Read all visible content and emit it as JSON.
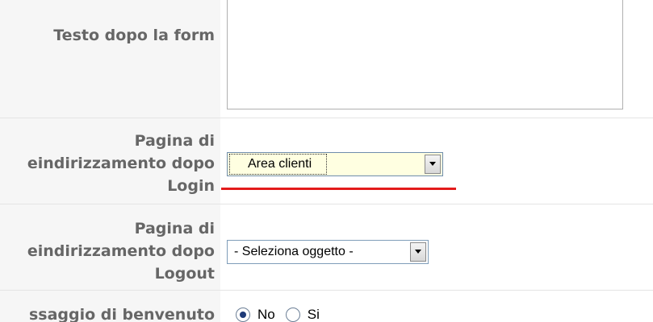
{
  "form": {
    "text_after_form": {
      "label": "Testo dopo la form",
      "value": ""
    },
    "login_redirect": {
      "label_line1": "Pagina di",
      "label_line2": "eindirizzamento dopo",
      "label_line3": "Login",
      "selected_value": "Area clienti"
    },
    "logout_redirect": {
      "label_line1": "Pagina di",
      "label_line2": "eindirizzamento dopo",
      "label_line3": "Logout",
      "selected_value": "- Seleziona oggetto -"
    },
    "welcome_message": {
      "label": "ssaggio di benvenuto",
      "options": [
        "No",
        "Si"
      ],
      "selected": "No"
    }
  },
  "icons": {
    "dropdown_arrow": "chevron-down-icon"
  },
  "colors": {
    "label_text": "#666666",
    "label_background": "#f6f6f6",
    "focused_select_background": "#ffffe1",
    "highlight_underline": "#e31b1b"
  }
}
